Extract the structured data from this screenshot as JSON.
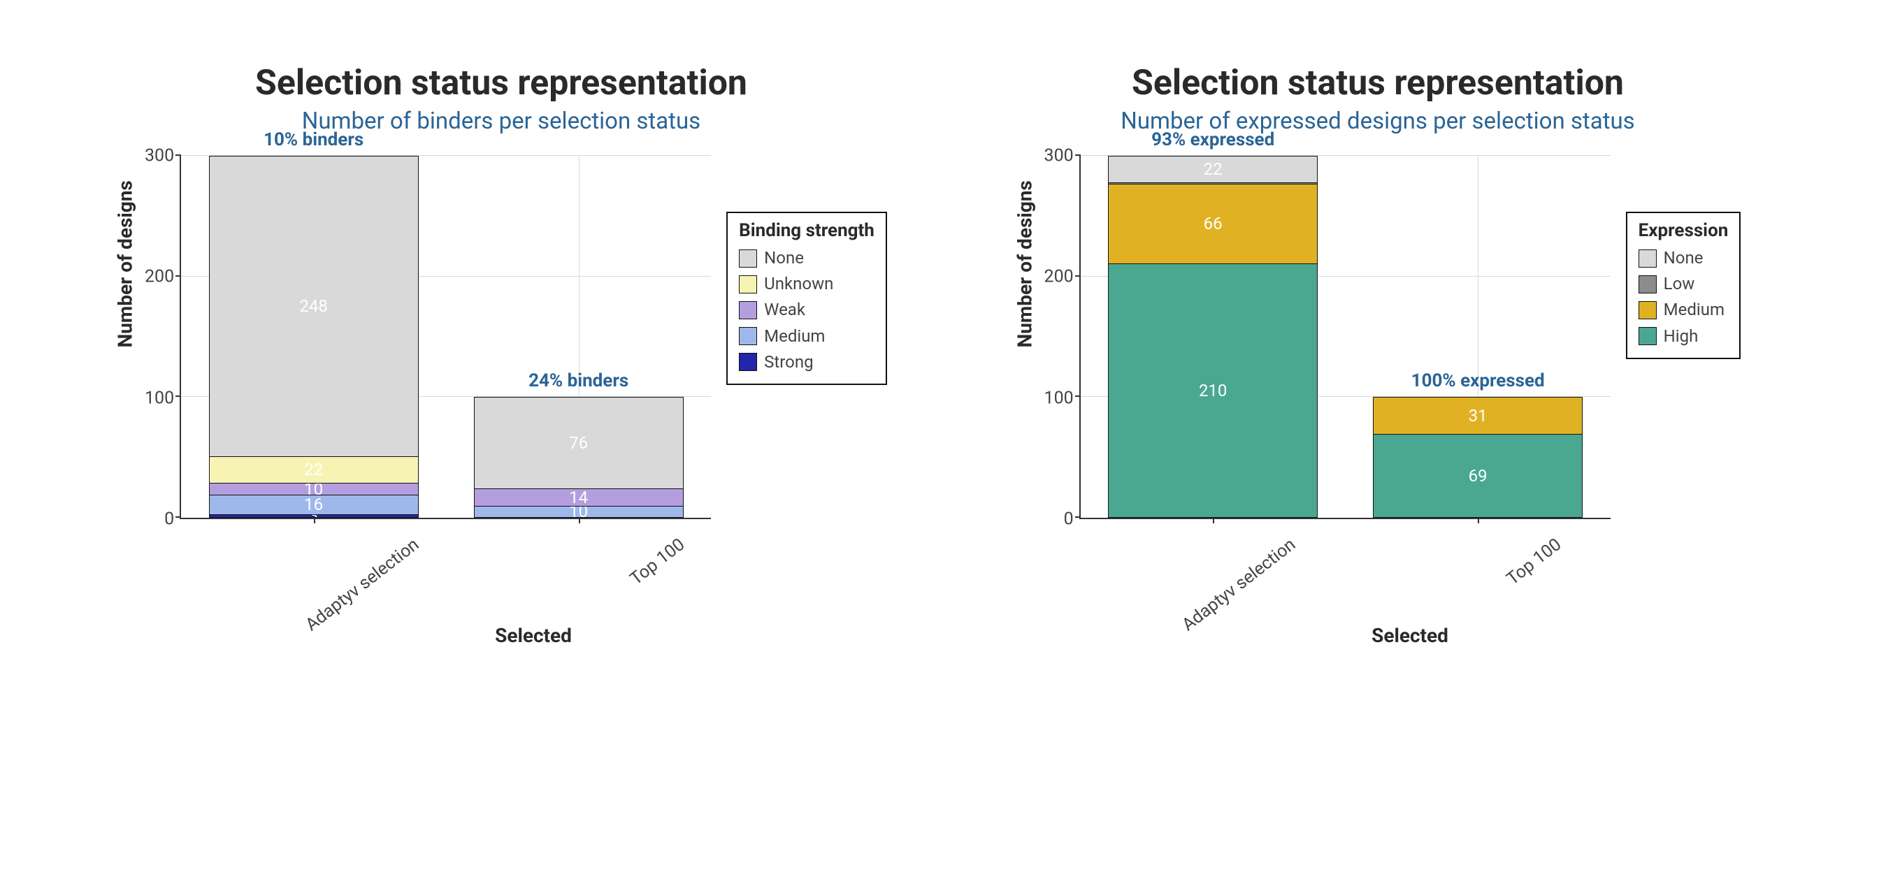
{
  "chart_data": [
    {
      "type": "bar",
      "stacked": true,
      "title": "Selection status representation",
      "subtitle": "Number of binders per selection status",
      "xlabel": "Selected",
      "ylabel": "Number of designs",
      "ylim": [
        0,
        300
      ],
      "yticks": [
        0,
        100,
        200,
        300
      ],
      "categories": [
        "Adaptyv selection",
        "Top 100"
      ],
      "top_labels": [
        "10% binders",
        "24% binders"
      ],
      "legend_title": "Binding strength",
      "series": [
        {
          "name": "None",
          "color": "#d9d9d9",
          "values": [
            248,
            76
          ]
        },
        {
          "name": "Unknown",
          "color": "#f7f4b3",
          "values": [
            22,
            0
          ]
        },
        {
          "name": "Weak",
          "color": "#b49ee0",
          "values": [
            10,
            14
          ]
        },
        {
          "name": "Medium",
          "color": "#9fb8ec",
          "values": [
            16,
            10
          ]
        },
        {
          "name": "Strong",
          "color": "#2226a8",
          "values": [
            3,
            0
          ]
        }
      ]
    },
    {
      "type": "bar",
      "stacked": true,
      "title": "Selection status representation",
      "subtitle": "Number of expressed designs per selection status",
      "xlabel": "Selected",
      "ylabel": "Number of designs",
      "ylim": [
        0,
        300
      ],
      "yticks": [
        0,
        100,
        200,
        300
      ],
      "categories": [
        "Adaptyv selection",
        "Top 100"
      ],
      "top_labels": [
        "93% expressed",
        "100% expressed"
      ],
      "legend_title": "Expression",
      "series": [
        {
          "name": "None",
          "color": "#d9d9d9",
          "values": [
            22,
            0
          ]
        },
        {
          "name": "Low",
          "color": "#8a8c8e",
          "values": [
            1,
            0
          ]
        },
        {
          "name": "Medium",
          "color": "#e0b223",
          "values": [
            66,
            31
          ]
        },
        {
          "name": "High",
          "color": "#4aa891",
          "values": [
            210,
            69
          ]
        }
      ]
    }
  ]
}
